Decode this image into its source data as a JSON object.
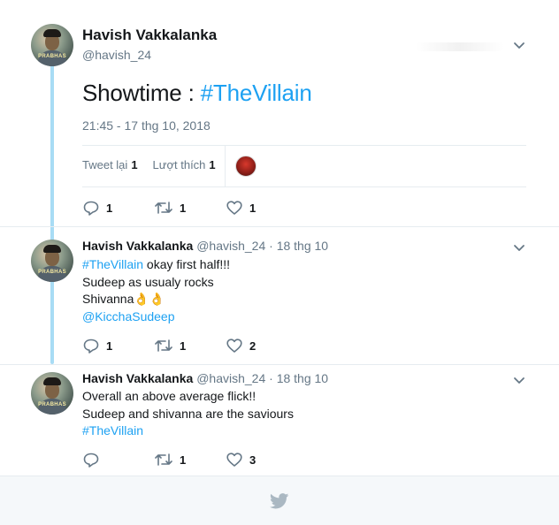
{
  "main_tweet": {
    "author_name": "Havish Vakkalanka",
    "author_handle": "@havish_24",
    "text_prefix": "Showtime : ",
    "hashtag": "#TheVillain",
    "timestamp": "21:45 - 17 thg 10, 2018",
    "retweets_label": "Tweet lại",
    "retweets_count": "1",
    "likes_label": "Lượt thích",
    "likes_count": "1",
    "reply_count": "1",
    "retweet_action_count": "1",
    "like_action_count": "1"
  },
  "avatar": {
    "caption": "PRABHAS"
  },
  "replies": [
    {
      "author_name": "Havish Vakkalanka",
      "author_handle": "@havish_24",
      "date": "· 18 thg 10",
      "line1_hashtag": "#TheVillain",
      "line1_rest": " okay first half!!!",
      "line2": "Sudeep as usualy rocks",
      "line3": "Shivanna",
      "line3_emoji": "👌👌",
      "line4_mention": "@KicchaSudeep",
      "reply_count": "1",
      "retweet_count": "1",
      "like_count": "2"
    },
    {
      "author_name": "Havish Vakkalanka",
      "author_handle": "@havish_24",
      "date": "· 18 thg 10",
      "line1": "Overall an above average flick!!",
      "line2": "Sudeep and shivanna are the saviours",
      "line3_hashtag": "#TheVillain",
      "reply_count": "",
      "retweet_count": "1",
      "like_count": "3"
    }
  ],
  "colors": {
    "link": "#1da1f2",
    "thread_line": "#a8dcf5",
    "muted": "#657786"
  },
  "icons": [
    "chevron-down-icon",
    "reply-icon",
    "retweet-icon",
    "heart-icon",
    "twitter-bird-icon"
  ]
}
